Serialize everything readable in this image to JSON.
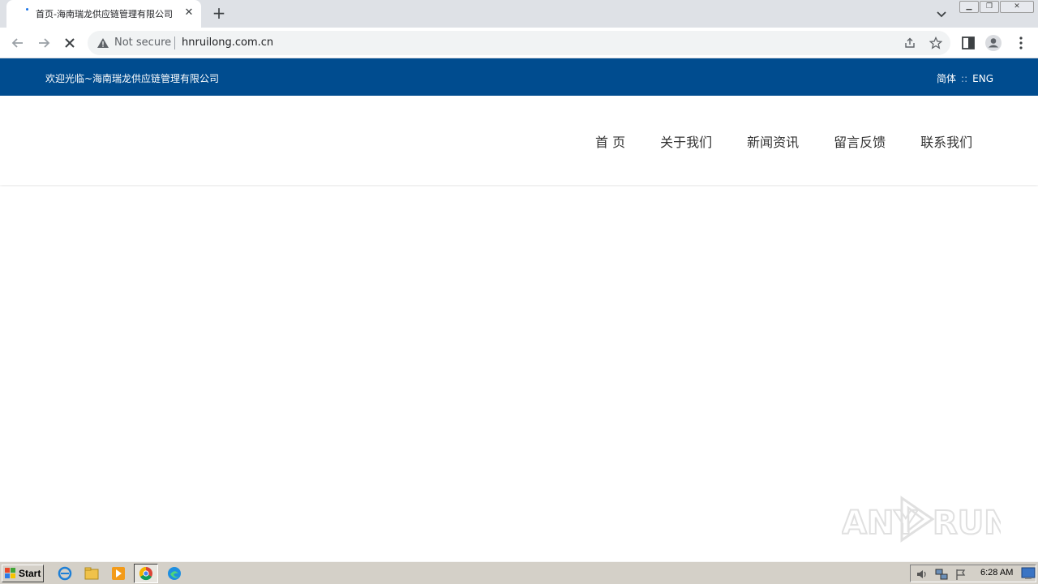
{
  "browser": {
    "tab": {
      "title": "首页-海南瑞龙供应链管理有限公司"
    },
    "address": {
      "security_label": "Not secure",
      "url": "hnruilong.com.cn"
    }
  },
  "page": {
    "topbar": {
      "welcome": "欢迎光临~海南瑞龙供应链管理有限公司",
      "lang_cn": "简体",
      "lang_sep": "::",
      "lang_en": "ENG"
    },
    "nav": [
      {
        "label": "首 页"
      },
      {
        "label": "关于我们"
      },
      {
        "label": "新闻资讯"
      },
      {
        "label": "留言反馈"
      },
      {
        "label": "联系我们"
      }
    ],
    "colors": {
      "topbar_bg": "#004c8f"
    }
  },
  "watermark": {
    "text": "ANY RUN"
  },
  "taskbar": {
    "start_label": "Start",
    "icons": [
      "ie-icon",
      "folder-icon",
      "media-player-icon",
      "chrome-icon",
      "edge-icon"
    ],
    "clock": "6:28 AM"
  }
}
